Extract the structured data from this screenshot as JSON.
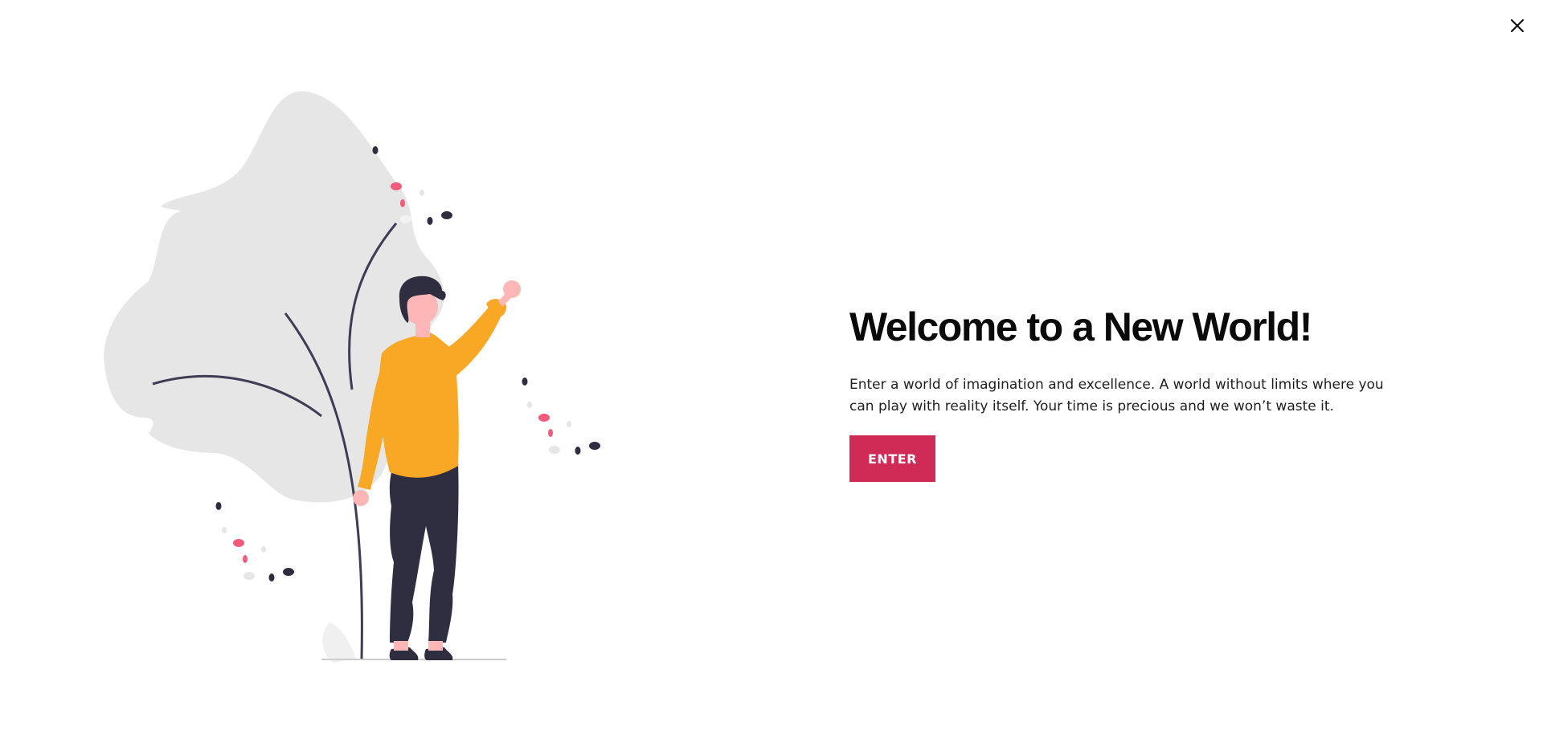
{
  "popup": {
    "close_icon": "close-icon",
    "title": "Welcome to a New World!",
    "description": "Enter a world of imagination and excellence. A world without limits where you can play with reality itself. Your time is precious and we won’t waste it.",
    "enter_label": "ENTER",
    "illustration": "person-waving-next-to-plant"
  },
  "colors": {
    "accent": "#d02a56",
    "shirt": "#f9a826",
    "dark": "#2f2e41",
    "skin": "#ffb6b6",
    "leaf": "#e6e6e6",
    "pink_dot": "#f15c7a"
  }
}
